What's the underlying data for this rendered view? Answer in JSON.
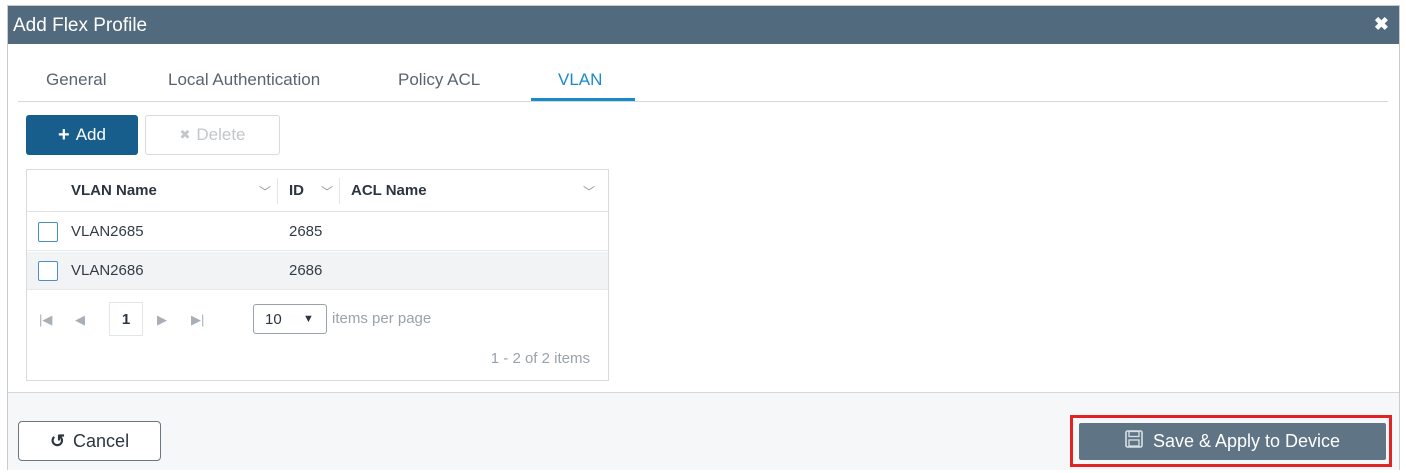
{
  "dialog": {
    "title": "Add Flex Profile",
    "close_glyph": "✖"
  },
  "tabs": [
    {
      "label": "General",
      "active": false
    },
    {
      "label": "Local Authentication",
      "active": false
    },
    {
      "label": "Policy ACL",
      "active": false
    },
    {
      "label": "VLAN",
      "active": true
    }
  ],
  "toolbar": {
    "add_label": "Add",
    "add_icon": "+",
    "delete_label": "Delete",
    "delete_icon": "✖"
  },
  "grid": {
    "columns": [
      "VLAN Name",
      "ID",
      "ACL Name"
    ],
    "rows": [
      {
        "vlan_name": "VLAN2685",
        "id": "2685",
        "acl_name": ""
      },
      {
        "vlan_name": "VLAN2686",
        "id": "2686",
        "acl_name": ""
      }
    ]
  },
  "pager": {
    "first_icon": "first-page-icon",
    "prev_icon": "prev-page-icon",
    "current_page": "1",
    "next_icon": "next-page-icon",
    "last_icon": "last-page-icon",
    "page_size": "10",
    "items_per_page_label": "items per page",
    "count_label": "1 - 2 of 2 items"
  },
  "footer": {
    "cancel_label": "Cancel",
    "save_label": "Save & Apply to Device",
    "highlight_color": "#e32224"
  },
  "colors": {
    "titlebar": "#526a7d",
    "accent": "#1a8ac8",
    "primary_button": "#175e8c",
    "save_button": "#5f7485"
  }
}
